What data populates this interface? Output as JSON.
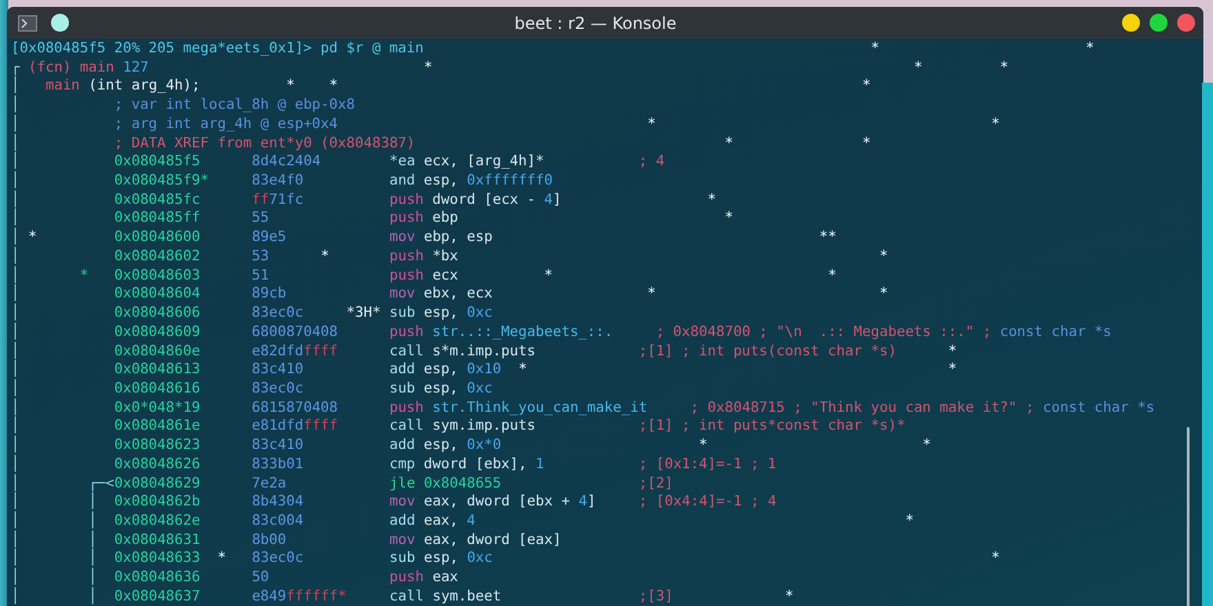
{
  "window": {
    "title": "beet : r2 — Konsole"
  },
  "terminal": {
    "lines": [
      {
        "segments": [
          {
            "kind": "prompt",
            "text": "[0x080485f5 20% 205 mega*eets_0x1]> pd $r @ main"
          },
          {
            "kind": "star",
            "text": "                                                    *"
          },
          {
            "kind": "star",
            "text": "                        *"
          }
        ]
      },
      {
        "segments": [
          {
            "kind": "graph",
            "text": "┌"
          },
          {
            "kind": "fn",
            "text": " (fcn) main"
          },
          {
            "kind": "num",
            "text": " 127"
          },
          {
            "kind": "star",
            "text": "                                *"
          },
          {
            "kind": "star",
            "text": "                                                        *"
          },
          {
            "kind": "star",
            "text": "         *"
          }
        ]
      },
      {
        "segments": [
          {
            "kind": "graph",
            "text": "│"
          },
          {
            "kind": "fn",
            "text": "   main"
          },
          {
            "kind": "white",
            "text": " (int arg_4h);"
          },
          {
            "kind": "star",
            "text": "          *"
          },
          {
            "kind": "star",
            "text": "    *"
          },
          {
            "kind": "star",
            "text": "                                                             *"
          }
        ]
      },
      {
        "segments": [
          {
            "kind": "graph",
            "text": "│"
          },
          {
            "kind": "meta",
            "text": "           ; var int local_8h @ ebp-0x8"
          }
        ]
      },
      {
        "segments": [
          {
            "kind": "graph",
            "text": "│"
          },
          {
            "kind": "meta",
            "text": "           ; arg int arg_4h @ esp+0x4"
          },
          {
            "kind": "star",
            "text": "                                    *"
          },
          {
            "kind": "star",
            "text": "                                       *"
          }
        ]
      },
      {
        "segments": [
          {
            "kind": "graph",
            "text": "│"
          },
          {
            "kind": "cmt",
            "text": "           ; DATA XREF from ent*y0 (0x8048387)"
          },
          {
            "kind": "star",
            "text": "                                    *"
          },
          {
            "kind": "star",
            "text": "               *"
          }
        ]
      },
      {
        "segments": [
          {
            "kind": "graph",
            "text": "│"
          },
          {
            "kind": "addr",
            "text": "           0x080485f5"
          },
          {
            "kind": "bytes",
            "text": "      8d4c2404"
          },
          {
            "kind": "op",
            "text": "        *ea"
          },
          {
            "kind": "arg",
            "text": " ecx, [arg_4h]*"
          },
          {
            "kind": "cmt",
            "text": "           ; 4"
          }
        ]
      },
      {
        "segments": [
          {
            "kind": "graph",
            "text": "│"
          },
          {
            "kind": "addr",
            "text": "           0x080485f9*"
          },
          {
            "kind": "bytes",
            "text": "     83e4f0"
          },
          {
            "kind": "op",
            "text": "          and"
          },
          {
            "kind": "arg",
            "text": " esp,"
          },
          {
            "kind": "num",
            "text": " 0xfffffff0"
          }
        ]
      },
      {
        "segments": [
          {
            "kind": "graph",
            "text": "│"
          },
          {
            "kind": "addr",
            "text": "           0x080485fc"
          },
          {
            "kind": "bytesff",
            "text": "      ff"
          },
          {
            "kind": "bytes",
            "text": "71fc"
          },
          {
            "kind": "push",
            "text": "          push"
          },
          {
            "kind": "arg",
            "text": " dword [ecx -"
          },
          {
            "kind": "num",
            "text": " 4"
          },
          {
            "kind": "arg",
            "text": "]"
          },
          {
            "kind": "star",
            "text": "                 *"
          }
        ]
      },
      {
        "segments": [
          {
            "kind": "graph",
            "text": "│"
          },
          {
            "kind": "addr",
            "text": "           0x080485ff"
          },
          {
            "kind": "bytes",
            "text": "      55"
          },
          {
            "kind": "push",
            "text": "              push"
          },
          {
            "kind": "arg",
            "text": " ebp"
          },
          {
            "kind": "star",
            "text": "                               *"
          }
        ]
      },
      {
        "segments": [
          {
            "kind": "graph",
            "text": "│"
          },
          {
            "kind": "star",
            "text": " *"
          },
          {
            "kind": "addr",
            "text": "         0x08048600"
          },
          {
            "kind": "bytes",
            "text": "      89e5"
          },
          {
            "kind": "mov",
            "text": "            mov"
          },
          {
            "kind": "arg",
            "text": " ebp, esp"
          },
          {
            "kind": "star",
            "text": "                                      *"
          },
          {
            "kind": "star",
            "text": "*"
          }
        ]
      },
      {
        "segments": [
          {
            "kind": "graph",
            "text": "│"
          },
          {
            "kind": "addr",
            "text": "           0x08048602"
          },
          {
            "kind": "bytes",
            "text": "      53"
          },
          {
            "kind": "star",
            "text": "      *"
          },
          {
            "kind": "push",
            "text": "       push"
          },
          {
            "kind": "arg",
            "text": " *bx"
          },
          {
            "kind": "star",
            "text": "                                                 *"
          }
        ]
      },
      {
        "segments": [
          {
            "kind": "graph",
            "text": "│"
          },
          {
            "kind": "addr",
            "text": "       *   0x08048603"
          },
          {
            "kind": "bytes",
            "text": "      51"
          },
          {
            "kind": "push",
            "text": "              push"
          },
          {
            "kind": "arg",
            "text": " ecx"
          },
          {
            "kind": "star",
            "text": "          *"
          },
          {
            "kind": "star",
            "text": "                                *"
          }
        ]
      },
      {
        "segments": [
          {
            "kind": "graph",
            "text": "│"
          },
          {
            "kind": "addr",
            "text": "           0x08048604"
          },
          {
            "kind": "bytes",
            "text": "      89cb"
          },
          {
            "kind": "mov",
            "text": "            mov"
          },
          {
            "kind": "arg",
            "text": " ebx, ecx"
          },
          {
            "kind": "star",
            "text": "                  *"
          },
          {
            "kind": "star",
            "text": "                          *"
          }
        ]
      },
      {
        "segments": [
          {
            "kind": "graph",
            "text": "│"
          },
          {
            "kind": "addr",
            "text": "           0x08048606"
          },
          {
            "kind": "bytes",
            "text": "      83ec0c"
          },
          {
            "kind": "white",
            "text": "     *3H*"
          },
          {
            "kind": "op",
            "text": " sub"
          },
          {
            "kind": "arg",
            "text": " esp,"
          },
          {
            "kind": "num",
            "text": " 0xc"
          }
        ]
      },
      {
        "segments": [
          {
            "kind": "graph",
            "text": "│"
          },
          {
            "kind": "addr",
            "text": "           0x08048609"
          },
          {
            "kind": "bytes",
            "text": "      6800870408"
          },
          {
            "kind": "push",
            "text": "      push"
          },
          {
            "kind": "str",
            "text": " str..::_Megabeets_::."
          },
          {
            "kind": "cmt",
            "text": "     ; 0x8048700 ; \"\\n  .:: Megabeets ::.\" ;"
          },
          {
            "kind": "meta",
            "text": " const char *s"
          }
        ]
      },
      {
        "segments": [
          {
            "kind": "graph",
            "text": "│"
          },
          {
            "kind": "addr",
            "text": "           0x0804860e"
          },
          {
            "kind": "bytes",
            "text": "      e82dfd"
          },
          {
            "kind": "bytesff",
            "text": "ffff"
          },
          {
            "kind": "op",
            "text": "      call"
          },
          {
            "kind": "arg",
            "text": " s*m.imp.puts"
          },
          {
            "kind": "cmt",
            "text": "            ;[1] ; int puts(const char *s)"
          },
          {
            "kind": "star",
            "text": "      *"
          }
        ]
      },
      {
        "segments": [
          {
            "kind": "graph",
            "text": "│"
          },
          {
            "kind": "addr",
            "text": "           0x08048613"
          },
          {
            "kind": "bytes",
            "text": "      83c410"
          },
          {
            "kind": "op",
            "text": "          add"
          },
          {
            "kind": "arg",
            "text": " esp,"
          },
          {
            "kind": "num",
            "text": " 0x10"
          },
          {
            "kind": "star",
            "text": "  *"
          },
          {
            "kind": "star",
            "text": "                                                 *"
          }
        ]
      },
      {
        "segments": [
          {
            "kind": "graph",
            "text": "│"
          },
          {
            "kind": "addr",
            "text": "           0x08048616"
          },
          {
            "kind": "bytes",
            "text": "      83ec0c"
          },
          {
            "kind": "op",
            "text": "          sub"
          },
          {
            "kind": "arg",
            "text": " esp,"
          },
          {
            "kind": "num",
            "text": " 0xc"
          }
        ]
      },
      {
        "segments": [
          {
            "kind": "graph",
            "text": "│"
          },
          {
            "kind": "addr",
            "text": "           0x0*048*19"
          },
          {
            "kind": "bytes",
            "text": "      6815870408"
          },
          {
            "kind": "push",
            "text": "      push"
          },
          {
            "kind": "str",
            "text": " str.Think_you_can_make_it"
          },
          {
            "kind": "cmt",
            "text": "     ; 0x8048715 ; \"Think you can make it?\" ;"
          },
          {
            "kind": "meta",
            "text": " const char *s"
          }
        ]
      },
      {
        "segments": [
          {
            "kind": "graph",
            "text": "│"
          },
          {
            "kind": "addr",
            "text": "           0x0804861e"
          },
          {
            "kind": "bytes",
            "text": "      e81dfd"
          },
          {
            "kind": "bytesff",
            "text": "ffff"
          },
          {
            "kind": "op",
            "text": "      call"
          },
          {
            "kind": "arg",
            "text": " sym.imp.puts"
          },
          {
            "kind": "cmt",
            "text": "            ;[1] ; int puts*const char *s)*"
          }
        ]
      },
      {
        "segments": [
          {
            "kind": "graph",
            "text": "│"
          },
          {
            "kind": "addr",
            "text": "           0x08048623"
          },
          {
            "kind": "bytes",
            "text": "      83c410"
          },
          {
            "kind": "op",
            "text": "          add"
          },
          {
            "kind": "arg",
            "text": " esp,"
          },
          {
            "kind": "num",
            "text": " 0x*0"
          },
          {
            "kind": "star",
            "text": "                       *"
          },
          {
            "kind": "star",
            "text": "                         *"
          }
        ]
      },
      {
        "segments": [
          {
            "kind": "graph",
            "text": "│"
          },
          {
            "kind": "addr",
            "text": "           0x08048626"
          },
          {
            "kind": "bytes",
            "text": "      833b01"
          },
          {
            "kind": "op",
            "text": "          cmp"
          },
          {
            "kind": "arg",
            "text": " dword [ebx],"
          },
          {
            "kind": "num",
            "text": " 1"
          },
          {
            "kind": "cmt",
            "text": "           ; [0x1:4]=-1 ; 1"
          }
        ]
      },
      {
        "segments": [
          {
            "kind": "graph",
            "text": "│"
          },
          {
            "kind": "graph",
            "text": "        ┌─<"
          },
          {
            "kind": "addr",
            "text": "0x08048629"
          },
          {
            "kind": "bytes",
            "text": "      7e2a"
          },
          {
            "kind": "jmp",
            "text": "            jle"
          },
          {
            "kind": "addr",
            "text": " 0x8048655"
          },
          {
            "kind": "cmt",
            "text": "                ;[2]"
          }
        ]
      },
      {
        "segments": [
          {
            "kind": "graph",
            "text": "│"
          },
          {
            "kind": "graph",
            "text": "        │"
          },
          {
            "kind": "addr",
            "text": "  0x0804862b"
          },
          {
            "kind": "bytes",
            "text": "      8b4304"
          },
          {
            "kind": "mov",
            "text": "          mov"
          },
          {
            "kind": "arg",
            "text": " eax, dword [ebx +"
          },
          {
            "kind": "num",
            "text": " 4"
          },
          {
            "kind": "arg",
            "text": "]"
          },
          {
            "kind": "cmt",
            "text": "     ; [0x4:4]=-1 ; 4"
          }
        ]
      },
      {
        "segments": [
          {
            "kind": "graph",
            "text": "│"
          },
          {
            "kind": "graph",
            "text": "        │"
          },
          {
            "kind": "addr",
            "text": "  0x0804862e"
          },
          {
            "kind": "bytes",
            "text": "      83c004"
          },
          {
            "kind": "op",
            "text": "          add"
          },
          {
            "kind": "arg",
            "text": " eax,"
          },
          {
            "kind": "num",
            "text": " 4"
          },
          {
            "kind": "star",
            "text": "                                                  *"
          }
        ]
      },
      {
        "segments": [
          {
            "kind": "graph",
            "text": "│"
          },
          {
            "kind": "graph",
            "text": "        │"
          },
          {
            "kind": "addr",
            "text": "  0x08048631"
          },
          {
            "kind": "bytes",
            "text": "      8b00"
          },
          {
            "kind": "mov",
            "text": "            mov"
          },
          {
            "kind": "arg",
            "text": " eax, dword [eax]"
          }
        ]
      },
      {
        "segments": [
          {
            "kind": "graph",
            "text": "│"
          },
          {
            "kind": "graph",
            "text": "        │"
          },
          {
            "kind": "addr",
            "text": "  0x08048633"
          },
          {
            "kind": "star",
            "text": "  *"
          },
          {
            "kind": "bytes",
            "text": "   83ec0c"
          },
          {
            "kind": "op",
            "text": "          sub"
          },
          {
            "kind": "arg",
            "text": " esp,"
          },
          {
            "kind": "num",
            "text": " 0xc"
          },
          {
            "kind": "star",
            "text": "                                                          *"
          }
        ]
      },
      {
        "segments": [
          {
            "kind": "graph",
            "text": "│"
          },
          {
            "kind": "graph",
            "text": "        │"
          },
          {
            "kind": "addr",
            "text": "  0x08048636"
          },
          {
            "kind": "bytes",
            "text": "      50"
          },
          {
            "kind": "push",
            "text": "              push"
          },
          {
            "kind": "arg",
            "text": " eax"
          }
        ]
      },
      {
        "segments": [
          {
            "kind": "graph",
            "text": "│"
          },
          {
            "kind": "graph",
            "text": "        │"
          },
          {
            "kind": "addr",
            "text": "  0x08048637"
          },
          {
            "kind": "bytes",
            "text": "      e849"
          },
          {
            "kind": "bytesff",
            "text": "ffffff*"
          },
          {
            "kind": "op",
            "text": "     call"
          },
          {
            "kind": "arg",
            "text": " sym.beet"
          },
          {
            "kind": "cmt",
            "text": "                ;[3]"
          },
          {
            "kind": "star",
            "text": "             *"
          }
        ]
      }
    ]
  }
}
